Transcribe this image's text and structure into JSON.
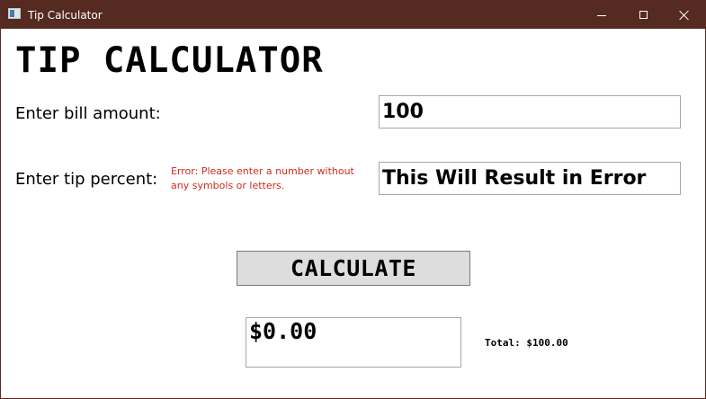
{
  "window": {
    "title": "Tip Calculator",
    "icon": "app-window-icon",
    "controls": {
      "minimize_icon": "minimize-icon",
      "maximize_icon": "maximize-icon",
      "close_icon": "close-icon"
    },
    "titlebar_color": "#552a21"
  },
  "app": {
    "heading": "TIP CALCULATOR",
    "bill": {
      "label": "Enter bill amount:",
      "value": "100"
    },
    "tip": {
      "label": "Enter tip percent:",
      "value": "This Will Result in Error",
      "error": "Error: Please enter a number without any symbols or letters.",
      "error_color": "#d12a1f"
    },
    "calculate_label": "CALCULATE",
    "result": "$0.00",
    "total": "Total: $100.00"
  }
}
